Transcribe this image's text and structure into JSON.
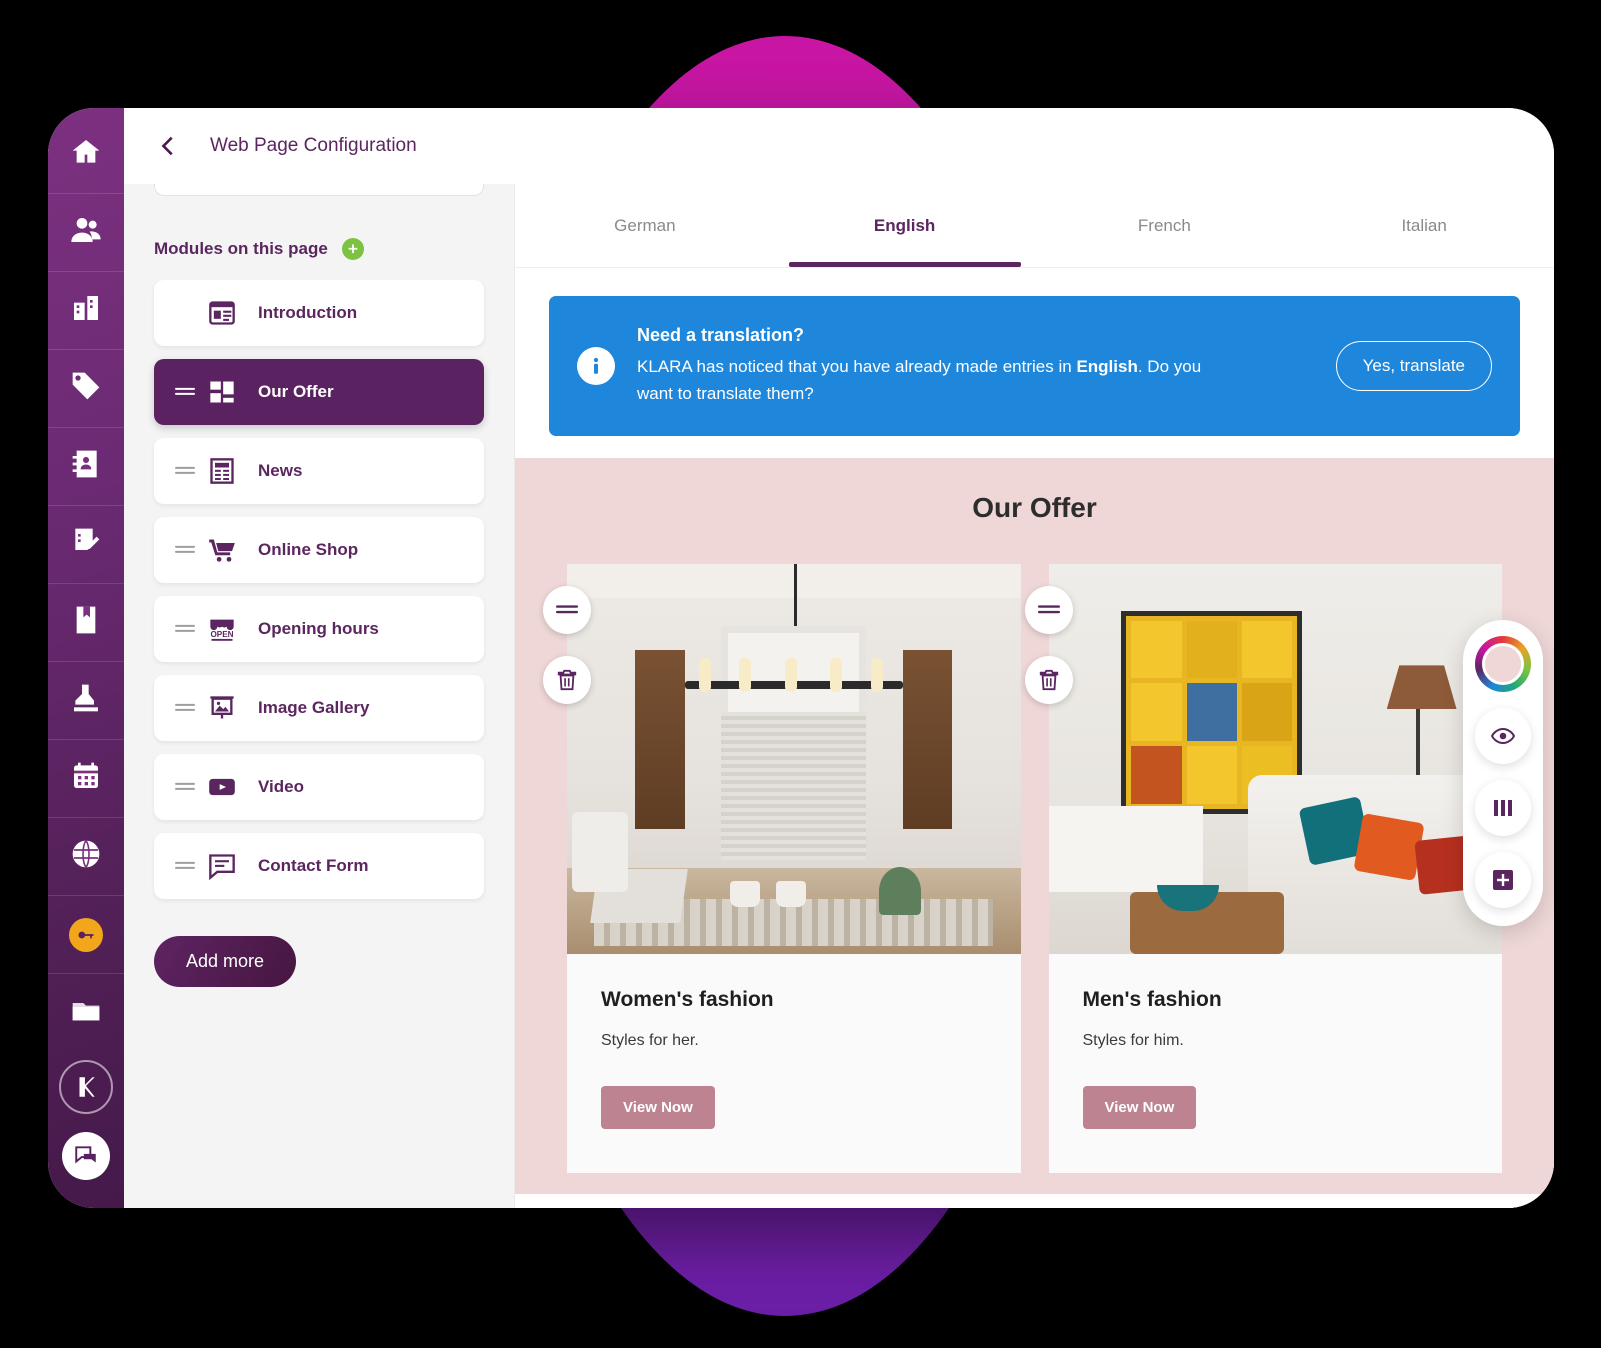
{
  "window": {
    "back_icon": "chevron-left-icon",
    "title": "Web Page Configuration"
  },
  "sidebar": {
    "items": [
      {
        "icon": "home-icon",
        "name": "home"
      },
      {
        "icon": "people-icon",
        "name": "contacts"
      },
      {
        "icon": "building-icon",
        "name": "company"
      },
      {
        "icon": "tag-icon",
        "name": "products"
      },
      {
        "icon": "address-book-icon",
        "name": "address-book"
      },
      {
        "icon": "checklist-edit-icon",
        "name": "tasks"
      },
      {
        "icon": "book-icon",
        "name": "journal"
      },
      {
        "icon": "stamp-icon",
        "name": "payroll"
      },
      {
        "icon": "calendar-icon",
        "name": "calendar"
      },
      {
        "icon": "www-globe-icon",
        "name": "website"
      },
      {
        "icon": "key-badge-icon",
        "name": "access"
      },
      {
        "icon": "folder-icon",
        "name": "documents"
      }
    ],
    "logo_icon": "klara-logo-icon",
    "chat_icon": "chat-bubbles-icon"
  },
  "modules_panel": {
    "heading": "Modules on this page",
    "add_icon": "plus-circle-icon",
    "add_more_label": "Add more",
    "items": [
      {
        "label": "Introduction",
        "icon": "article-card-icon",
        "draggable": false,
        "active": false
      },
      {
        "label": "Our Offer",
        "icon": "grid-blocks-icon",
        "draggable": true,
        "active": true
      },
      {
        "label": "News",
        "icon": "newspaper-icon",
        "draggable": true,
        "active": false
      },
      {
        "label": "Online Shop",
        "icon": "shopping-cart-icon",
        "draggable": true,
        "active": false
      },
      {
        "label": "Opening hours",
        "icon": "open-sign-icon",
        "draggable": true,
        "active": false
      },
      {
        "label": "Image Gallery",
        "icon": "image-frame-icon",
        "draggable": true,
        "active": false
      },
      {
        "label": "Video",
        "icon": "video-play-icon",
        "draggable": true,
        "active": false
      },
      {
        "label": "Contact Form",
        "icon": "speech-form-icon",
        "draggable": true,
        "active": false
      }
    ]
  },
  "preview": {
    "language_tabs": [
      {
        "label": "German",
        "active": false
      },
      {
        "label": "English",
        "active": true
      },
      {
        "label": "French",
        "active": false
      },
      {
        "label": "Italian",
        "active": false
      }
    ],
    "banner": {
      "info_icon": "info-icon",
      "title": "Need a translation?",
      "body_part1": "KLARA has noticed that you have already made entries in ",
      "body_bold": "English",
      "body_part2": ". Do you want to translate them?",
      "button_label": "Yes, translate",
      "color": "#1E87DC"
    },
    "offer": {
      "title": "Our Offer",
      "background_color": "#EFD7D7",
      "cards": [
        {
          "title": "Women's fashion",
          "subtitle": "Styles for her.",
          "button_label": "View Now",
          "drag_icon": "drag-handle-icon",
          "delete_icon": "trash-icon"
        },
        {
          "title": "Men's fashion",
          "subtitle": "Styles for him.",
          "button_label": "View Now",
          "drag_icon": "drag-handle-icon",
          "delete_icon": "trash-icon"
        }
      ],
      "card_button_color": "#BE8390"
    }
  },
  "float_toolbar": {
    "items": [
      {
        "icon": "color-wheel-icon",
        "name": "theme-color"
      },
      {
        "icon": "eye-icon",
        "name": "preview"
      },
      {
        "icon": "columns-icon",
        "name": "layout"
      },
      {
        "icon": "plus-square-icon",
        "name": "add-element"
      }
    ]
  },
  "decoration": {
    "blob_gradient_top": "#C915A3",
    "blob_gradient_bottom": "#6B1FA8",
    "accent_purple": "#5B2660"
  }
}
